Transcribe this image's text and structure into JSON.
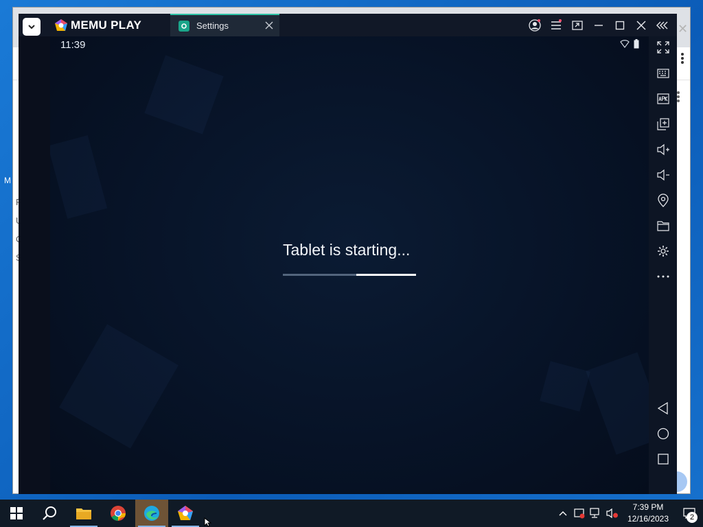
{
  "emulator": {
    "brand": "MEMU PLAY",
    "tab_label": "Settings",
    "clock": "11:39",
    "status_text": "Tablet is starting...",
    "progress_fraction": 0.45,
    "accent": "#2ec4a6"
  },
  "titlebar_icons": [
    "account-icon",
    "menu-icon",
    "screen-record-icon",
    "minimize-icon",
    "maximize-icon",
    "close-icon",
    "collapse-sidebar-icon"
  ],
  "sidebar_icons": [
    "fullscreen-icon",
    "keyboard-mapping-icon",
    "apk-install-icon",
    "multi-instance-icon",
    "volume-up-icon",
    "volume-down-icon",
    "location-icon",
    "shared-folder-icon",
    "settings-icon",
    "more-icon",
    "back-nav-icon",
    "home-nav-icon",
    "recents-nav-icon"
  ],
  "background_window": {
    "side_chars": [
      "F",
      "U",
      "C",
      "S"
    ],
    "desktop_chars": [
      "M"
    ]
  },
  "taskbar": {
    "items": [
      "start-button",
      "search-button",
      "file-explorer",
      "chrome",
      "edge",
      "memu"
    ],
    "time": "7:39 PM",
    "date": "12/16/2023",
    "notification_count": "2"
  }
}
